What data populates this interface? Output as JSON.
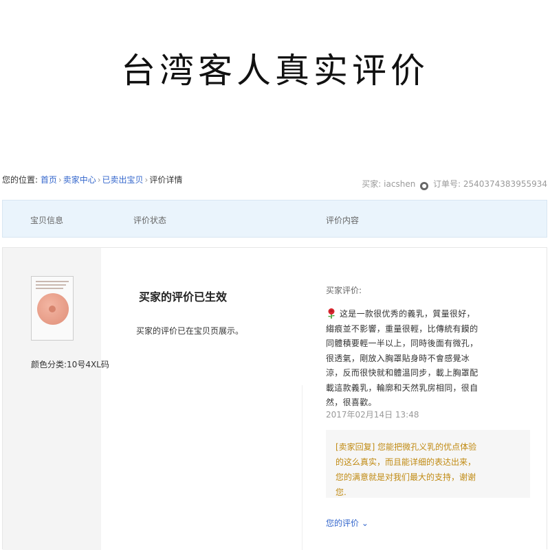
{
  "headline": "台湾客人真实评价",
  "breadcrumb": {
    "label": "您的位置:",
    "links": [
      "首页",
      "卖家中心",
      "已卖出宝贝"
    ],
    "current": "评价详情"
  },
  "order_meta": {
    "buyer_label": "买家:",
    "buyer_name": "iacshen",
    "order_label": "订单号:",
    "order_number": "2540374383955934"
  },
  "table_headers": [
    "宝贝信息",
    "评价状态",
    "评价内容"
  ],
  "item": {
    "variant": "颜色分类:10号4XL码"
  },
  "status": {
    "title": "买家的评价已生效",
    "note": "买家的评价已在宝贝页展示。"
  },
  "review": {
    "label": "买家评价:",
    "text": "这是一款很优秀的義乳，質量很好，縐痕並不影響，重量很輕，比傳統有饃的同體積要輕一半以上，同時後面有微孔，很透氣，剛放入胸罩貼身時不會感覺冰涼，反而很快就和體溫同步，載上胸罩配載這款義乳，輪廓和天然乳房相同，很自然，很喜歡。",
    "time": "2017年02月14日 13:48"
  },
  "seller_reply": {
    "text": "[卖家回复] 您能把微孔义乳的优点体验的这么真实，而且能详细的表达出来，您的满意就是对我们最大的支持，谢谢您."
  },
  "your_review_link": "您的评价",
  "colors": {
    "link": "#3366cc",
    "reply": "#c08a12",
    "header_bg": "#eaf4fc"
  }
}
